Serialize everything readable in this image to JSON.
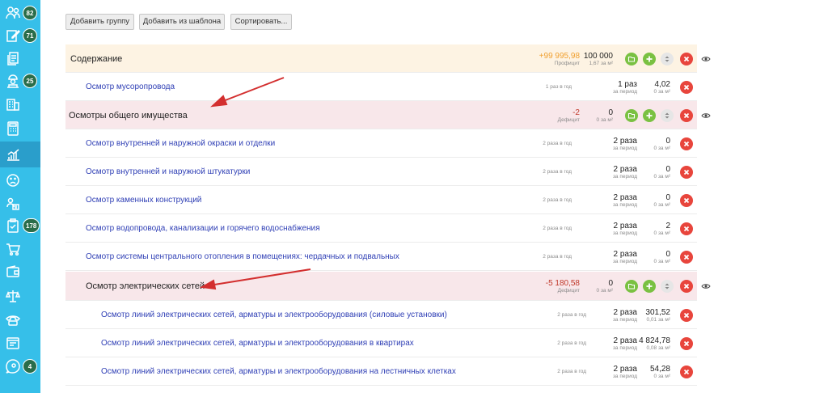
{
  "sidebar": {
    "items": [
      {
        "icon": "users-group-icon",
        "badge": "82"
      },
      {
        "icon": "edit-note-icon",
        "badge": "71"
      },
      {
        "icon": "documents-icon",
        "badge": ""
      },
      {
        "icon": "worker-icon",
        "badge": "25"
      },
      {
        "icon": "building-icon",
        "badge": ""
      },
      {
        "icon": "calculator-icon",
        "badge": ""
      },
      {
        "icon": "chart-icon",
        "badge": "",
        "active": true
      },
      {
        "icon": "sad-face-icon",
        "badge": ""
      },
      {
        "icon": "team-icon",
        "badge": ""
      },
      {
        "icon": "clipboard-icon",
        "badge": "178"
      },
      {
        "icon": "cart-icon",
        "badge": ""
      },
      {
        "icon": "wallet-icon",
        "badge": ""
      },
      {
        "icon": "scales-icon",
        "badge": ""
      },
      {
        "icon": "phone-icon",
        "badge": ""
      },
      {
        "icon": "list-card-icon",
        "badge": ""
      },
      {
        "icon": "chat-location-icon",
        "badge": "4"
      }
    ]
  },
  "toolbar": {
    "add_group": "Добавить группу",
    "add_from_template": "Добавить из шаблона",
    "sort": "Сортировать..."
  },
  "rows": [
    {
      "title": "Содержание",
      "freq": "",
      "count": "",
      "count_sub": "",
      "amount": "100 000",
      "amount_sub": "1,67 за м²",
      "balance": "+99 995,98",
      "balance_sub": "Профицит",
      "balance_color": "#f0a030"
    },
    {
      "title": "Осмотр мусоропровода",
      "freq": "1 раз в год",
      "count": "1 раз",
      "count_sub": "за период",
      "amount": "4,02",
      "amount_sub": "0 за м²",
      "balance": "",
      "balance_sub": ""
    },
    {
      "title": "Осмотры общего имущества",
      "freq": "",
      "count": "",
      "count_sub": "",
      "amount": "0",
      "amount_sub": "0 за м²",
      "balance": "-2",
      "balance_sub": "Дефицит",
      "balance_color": "#c0392b"
    },
    {
      "title": "Осмотр внутренней и наружной окраски и отделки",
      "freq": "2 раза в год",
      "count": "2 раза",
      "count_sub": "за период",
      "amount": "0",
      "amount_sub": "0 за м²",
      "balance": "",
      "balance_sub": ""
    },
    {
      "title": "Осмотр внутренней и наружной штукатурки",
      "freq": "2 раза в год",
      "count": "2 раза",
      "count_sub": "за период",
      "amount": "0",
      "amount_sub": "0 за м²",
      "balance": "",
      "balance_sub": ""
    },
    {
      "title": "Осмотр каменных конструкций",
      "freq": "2 раза в год",
      "count": "2 раза",
      "count_sub": "за период",
      "amount": "0",
      "amount_sub": "0 за м²",
      "balance": "",
      "balance_sub": ""
    },
    {
      "title": "Осмотр водопровода, канализации и горячего водоснабжения",
      "freq": "2 раза в год",
      "count": "2 раза",
      "count_sub": "за период",
      "amount": "2",
      "amount_sub": "0 за м²",
      "balance": "",
      "balance_sub": ""
    },
    {
      "title": "Осмотр системы центрального отопления в помещениях: чердачных и подвальных",
      "freq": "2 раза в год",
      "count": "2 раза",
      "count_sub": "за период",
      "amount": "0",
      "amount_sub": "0 за м²",
      "balance": "",
      "balance_sub": ""
    },
    {
      "title": "Осмотр электрических сетей",
      "freq": "",
      "count": "",
      "count_sub": "",
      "amount": "0",
      "amount_sub": "0 за м²",
      "balance": "-5 180,58",
      "balance_sub": "Дефицит",
      "balance_color": "#c0392b"
    },
    {
      "title": "Осмотр линий электрических сетей, арматуры и электрооборудования (силовые установки)",
      "freq": "2 раза в год",
      "count": "2 раза",
      "count_sub": "за период",
      "amount": "301,52",
      "amount_sub": "0,01 за м²",
      "balance": "",
      "balance_sub": ""
    },
    {
      "title": "Осмотр линий электрических сетей, арматуры и электрооборудования в квартирах",
      "freq": "2 раза в год",
      "count": "2 раза",
      "count_sub": "за период",
      "amount": "4 824,78",
      "amount_sub": "0,08 за м²",
      "balance": "",
      "balance_sub": ""
    },
    {
      "title": "Осмотр линий электрических сетей, арматуры и электрооборудования на лестничных клетках",
      "freq": "2 раза в год",
      "count": "2 раза",
      "count_sub": "за период",
      "amount": "54,28",
      "amount_sub": "0 за м²",
      "balance": "",
      "balance_sub": ""
    }
  ],
  "colors": {
    "sidebar": "#36bfe9",
    "badge": "#2a6d4a",
    "green_button": "#7ac142",
    "red_button": "#e8453c",
    "link": "#2f3fb5",
    "arrow": "#d32f2f"
  }
}
